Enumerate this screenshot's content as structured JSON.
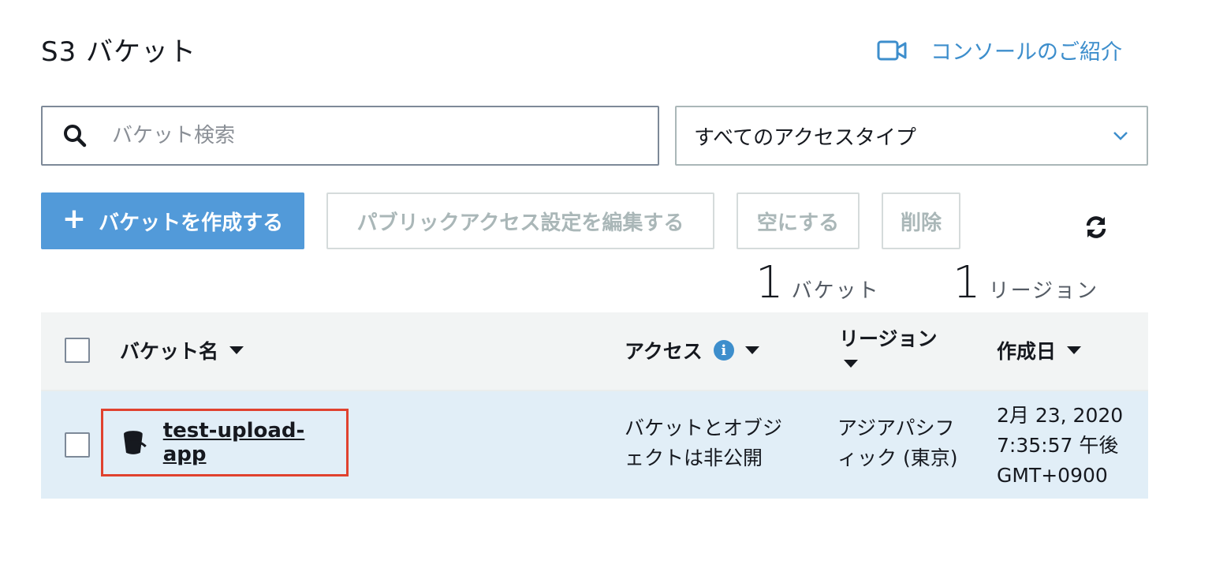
{
  "header": {
    "title": "S3 バケット",
    "intro_link": "コンソールのご紹介"
  },
  "search": {
    "placeholder": "バケット検索"
  },
  "filter": {
    "selected": "すべてのアクセスタイプ"
  },
  "toolbar": {
    "create_label": "バケットを作成する",
    "edit_public_access_label": "パブリックアクセス設定を編集する",
    "empty_label": "空にする",
    "delete_label": "削除"
  },
  "summary": {
    "bucket_count": "1",
    "bucket_label": "バケット",
    "region_count": "1",
    "region_label": "リージョン"
  },
  "table": {
    "columns": {
      "name": "バケット名",
      "access": "アクセス",
      "region": "リージョン",
      "created": "作成日"
    },
    "rows": [
      {
        "name": "test-upload-app",
        "access_line1": "バケットとオブジ",
        "access_line2": "ェクトは非公開",
        "region_line1": "アジアパシフ",
        "region_line2": "ィック (東京)",
        "created_line1": "2月 23, 2020",
        "created_line2": "7:35:57 午後",
        "created_line3": "GMT+0900"
      }
    ]
  },
  "colors": {
    "accent": "#529ad9",
    "link": "#3d8ecc",
    "row_selected_bg": "#e1eef7",
    "highlight_border": "#e0422f"
  },
  "icons": {
    "intro": "video-camera-icon",
    "search": "search-icon",
    "dropdown": "chevron-down-icon",
    "add": "plus-icon",
    "refresh": "refresh-icon",
    "info": "info-icon",
    "bucket": "bucket-icon"
  }
}
